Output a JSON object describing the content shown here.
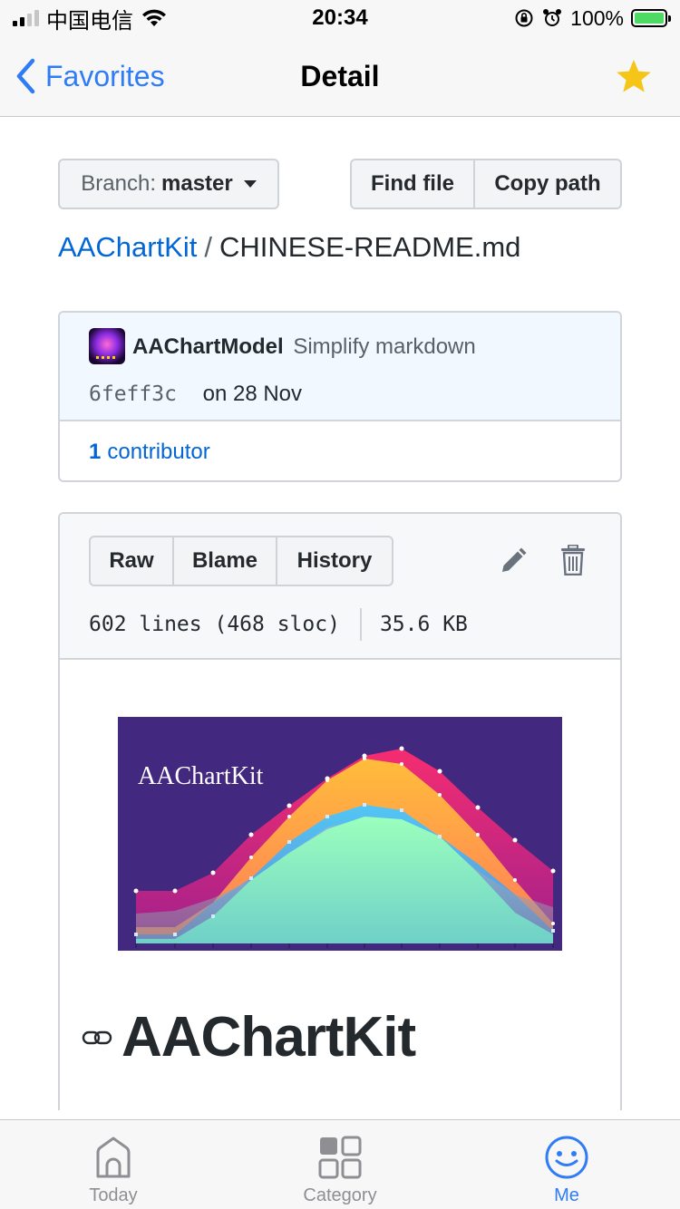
{
  "status_bar": {
    "carrier": "中国电信",
    "time": "20:34",
    "battery_percent": "100%",
    "signal_bars": 4,
    "signal_bars_active": 2
  },
  "nav": {
    "back_label": "Favorites",
    "title": "Detail",
    "star_color": "#f5c518",
    "accent_color": "#2f7cf6"
  },
  "branch": {
    "label": "Branch:",
    "name": "master"
  },
  "file_actions": {
    "find_file": "Find file",
    "copy_path": "Copy path"
  },
  "breadcrumb": {
    "repo": "AAChartKit",
    "separator": "/",
    "file": "CHINESE-README.md"
  },
  "commit": {
    "author": "AAChartModel",
    "message": "Simplify markdown",
    "sha": "6feff3c",
    "date": "on 28 Nov",
    "contributors_count": "1",
    "contributors_label": "contributor"
  },
  "file_toolbar": {
    "raw": "Raw",
    "blame": "Blame",
    "history": "History",
    "edit_icon": "pencil-icon",
    "delete_icon": "trash-icon"
  },
  "file_info": {
    "lines": "602 lines (468 sloc)",
    "size": "35.6 KB"
  },
  "readme": {
    "banner_title": "AAChartKit",
    "heading": "AAChartKit",
    "banner_background": "#43287f"
  },
  "tabs": [
    {
      "label": "Today",
      "icon": "home-icon",
      "active": false
    },
    {
      "label": "Category",
      "icon": "grid-icon",
      "active": false
    },
    {
      "label": "Me",
      "icon": "smiley-face-icon",
      "active": true
    }
  ]
}
